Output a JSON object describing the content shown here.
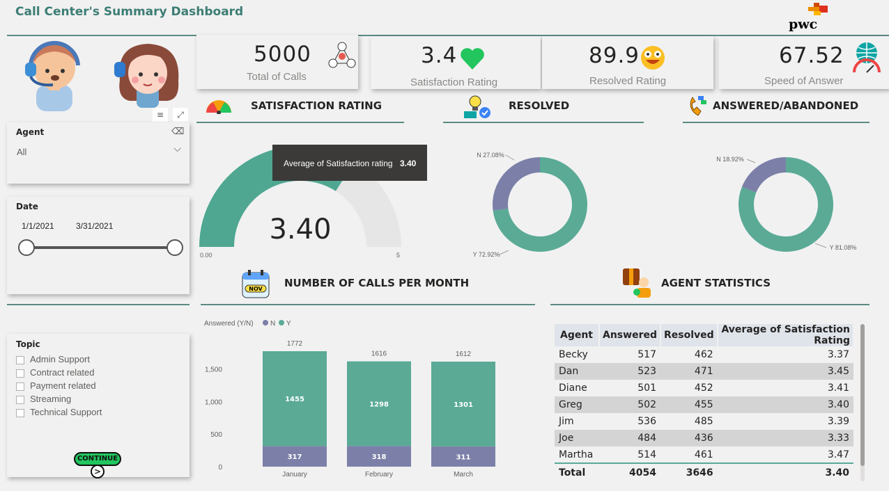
{
  "header": {
    "title": "Call Center's Summary Dashboard",
    "brand": "pwc"
  },
  "kpis": [
    {
      "value": "5000",
      "label": "Total of Calls",
      "icon": "network-icon"
    },
    {
      "value": "3.4",
      "label": "Satisfaction Rating",
      "icon": "heart-icon"
    },
    {
      "value": "89.9",
      "label": "Resolved Rating",
      "icon": "smiley-icon"
    },
    {
      "value": "67.52",
      "label": "Speed of Answer",
      "icon": "gauge-icon"
    }
  ],
  "sections": {
    "satisfaction": "SATISFACTION RATING",
    "resolved": "RESOLVED",
    "answered": "ANSWERED/ABANDONED",
    "calls_month": "NUMBER OF CALLS PER MONTH",
    "agent_stats": "AGENT STATISTICS"
  },
  "slicers": {
    "agent": {
      "label": "Agent",
      "value": "All"
    },
    "date": {
      "label": "Date",
      "start": "1/1/2021",
      "end": "3/31/2021"
    },
    "topic": {
      "label": "Topic",
      "options": [
        "Admin Support",
        "Contract related",
        "Payment related",
        "Streaming",
        "Technical Support"
      ]
    }
  },
  "continue_label": "CONTINUE",
  "gauge": {
    "value": 3.4,
    "min": 0,
    "max": 5,
    "display": "3.40",
    "min_label": "0.00",
    "max_label": "5",
    "tooltip_label": "Average of Satisfaction rating",
    "tooltip_value": "3.40",
    "color": "#4fa792",
    "track": "#e6e6e6"
  },
  "colors": {
    "Y": "#5aaa96",
    "N": "#7c80a8",
    "accent": "#3c7d74"
  },
  "chart_data": [
    {
      "type": "pie",
      "name": "RESOLVED",
      "labels": [
        "Y",
        "N"
      ],
      "values": [
        72.92,
        27.08
      ],
      "label_text": [
        "Y 72.92%",
        "N 27.08%"
      ]
    },
    {
      "type": "pie",
      "name": "ANSWERED/ABANDONED",
      "labels": [
        "Y",
        "N"
      ],
      "values": [
        81.08,
        18.92
      ],
      "label_text": [
        "Y 81.08%",
        "N 18.92%"
      ]
    },
    {
      "type": "bar",
      "stacked": true,
      "legend_title": "Answered (Y/N)",
      "categories": [
        "January",
        "February",
        "March"
      ],
      "series": [
        {
          "name": "N",
          "values": [
            317,
            318,
            311
          ]
        },
        {
          "name": "Y",
          "values": [
            1455,
            1298,
            1301
          ]
        }
      ],
      "totals": [
        1772,
        1616,
        1612
      ],
      "yticks": [
        0,
        500,
        1000,
        1500
      ],
      "ytick_labels": [
        "0",
        "500",
        "1,000",
        "1,500"
      ],
      "ylim": [
        0,
        1772
      ]
    }
  ],
  "agent_table": {
    "headers": [
      "Agent",
      "Answered",
      "Resolved",
      "Average of Satisfaction Rating"
    ],
    "rows": [
      [
        "Becky",
        "517",
        "462",
        "3.37"
      ],
      [
        "Dan",
        "523",
        "471",
        "3.45"
      ],
      [
        "Diane",
        "501",
        "452",
        "3.41"
      ],
      [
        "Greg",
        "502",
        "455",
        "3.40"
      ],
      [
        "Jim",
        "536",
        "485",
        "3.39"
      ],
      [
        "Joe",
        "484",
        "436",
        "3.33"
      ],
      [
        "Martha",
        "514",
        "461",
        "3.47"
      ]
    ],
    "total": [
      "Total",
      "4054",
      "3646",
      "3.40"
    ]
  }
}
